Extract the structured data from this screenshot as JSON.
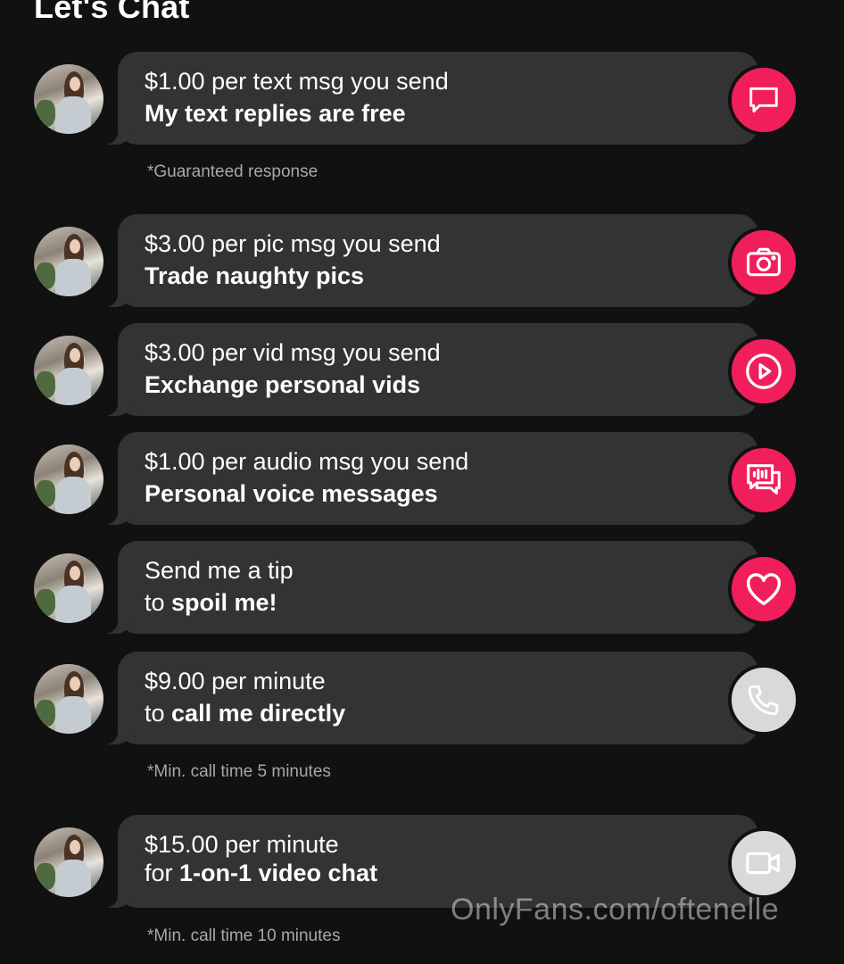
{
  "header": {
    "title": "Let's Chat"
  },
  "offers": [
    {
      "line1": "$1.00 per text msg you send",
      "line2_prefix": "",
      "line2_bold": "My text replies are free",
      "icon": "chat-icon",
      "icon_bg": "#f01f5c",
      "note": "*Guaranteed response"
    },
    {
      "line1": "$3.00 per pic msg you send",
      "line2_prefix": "",
      "line2_bold": "Trade naughty pics",
      "icon": "camera-icon",
      "icon_bg": "#f01f5c",
      "note": ""
    },
    {
      "line1": "$3.00 per vid msg you send",
      "line2_prefix": "",
      "line2_bold": "Exchange personal vids",
      "icon": "play-icon",
      "icon_bg": "#f01f5c",
      "note": ""
    },
    {
      "line1": "$1.00 per audio msg you send",
      "line2_prefix": "",
      "line2_bold": "Personal voice messages",
      "icon": "voice-message-icon",
      "icon_bg": "#f01f5c",
      "note": ""
    },
    {
      "line1": "Send me a tip",
      "line2_prefix": "to ",
      "line2_bold": "spoil me!",
      "icon": "heart-icon",
      "icon_bg": "#f01f5c",
      "note": ""
    },
    {
      "line1": "$9.00 per minute",
      "line2_prefix": "to ",
      "line2_bold": "call me directly",
      "icon": "phone-icon",
      "icon_bg": "#d9d9d9",
      "note": "*Min. call time 5 minutes"
    },
    {
      "line1": "$15.00 per minute",
      "line2_prefix": "for ",
      "line2_bold": "1-on-1 video chat",
      "icon": "video-camera-icon",
      "icon_bg": "#d9d9d9",
      "note": "*Min. call time 10 minutes"
    }
  ],
  "watermark": "OnlyFans.com/oftenelle",
  "colors": {
    "accent": "#f01f5c",
    "bubble": "#333333",
    "background": "#111111",
    "disabled": "#d9d9d9"
  }
}
